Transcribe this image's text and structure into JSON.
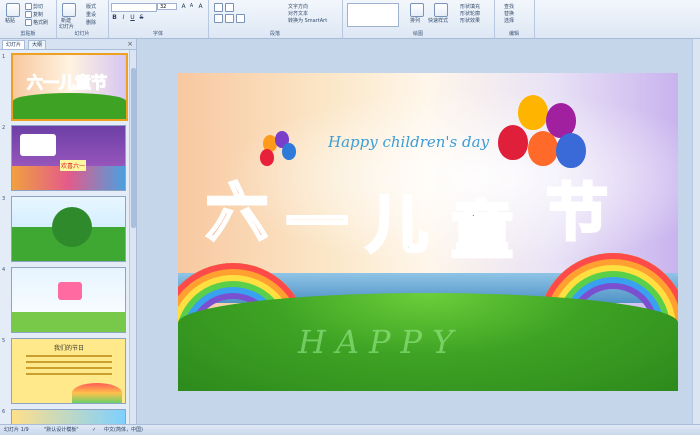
{
  "ribbon": {
    "clipboard": {
      "paste": "粘贴",
      "cut": "剪切",
      "copy": "复制",
      "format_painter": "格式刷",
      "label": "剪贴板"
    },
    "slides": {
      "new_slide": "新建",
      "new_slide2": "幻灯片",
      "layout": "版式",
      "reset": "重设",
      "delete": "删除",
      "label": "幻灯片"
    },
    "font": {
      "font_name": "",
      "font_size": "32",
      "grow": "A",
      "shrink": "A",
      "clear": "A",
      "bold": "B",
      "italic": "I",
      "underline": "U",
      "strike": "S",
      "label": "字体"
    },
    "paragraph": {
      "text_direction": "文字方向",
      "align_text": "对齐文本",
      "smartart": "转换为 SmartArt",
      "label": "段落"
    },
    "drawing": {
      "arrange": "排列",
      "quick_styles": "快速样式",
      "shape_fill": "形状填充",
      "shape_outline": "形状轮廓",
      "shape_effects": "形状效果",
      "label": "绘图"
    },
    "editing": {
      "find": "查找",
      "replace": "替换",
      "select": "选择",
      "label": "编辑"
    }
  },
  "pane": {
    "tab_slides": "幻灯片",
    "tab_outline": "大纲",
    "close": "×",
    "thumbs": [
      {
        "num": "1"
      },
      {
        "num": "2",
        "text": "欢喜六一"
      },
      {
        "num": "3"
      },
      {
        "num": "4"
      },
      {
        "num": "5",
        "title": "我们的节日"
      },
      {
        "num": "6"
      }
    ]
  },
  "slide": {
    "tagline": "Happy children's day",
    "title": [
      "六",
      "一",
      "儿",
      "童",
      "节"
    ],
    "grass_word": "HAPPY"
  },
  "status": {
    "slide_of": "幻灯片 1/9",
    "theme": "\"默认设计模板\"",
    "language": "中文(简体，中国)"
  },
  "colors": {
    "title_glyphs": [
      "#ff6a2a",
      "#ffb400",
      "#7acb2e",
      "#2b8fe0",
      "#ff4d6d"
    ],
    "selected_border": "#f0a020"
  }
}
